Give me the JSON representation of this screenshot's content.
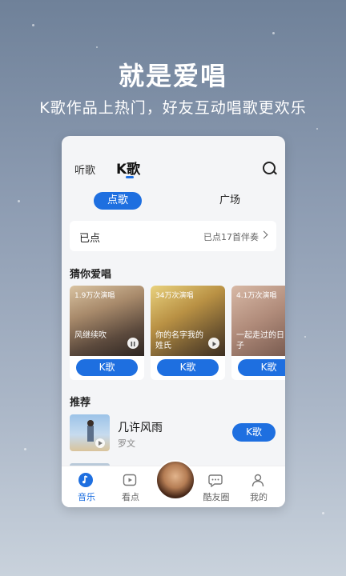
{
  "headline": "就是爱唱",
  "subline": "K歌作品上热门，好友互动唱歌更欢乐",
  "topbar": {
    "tab_listen": "听歌",
    "tab_k": "K歌"
  },
  "segments": {
    "active": "点歌",
    "plaza": "广场"
  },
  "ordered": {
    "label": "已点",
    "count": "已点17首伴奏"
  },
  "guess": {
    "title": "猜你爱唱",
    "cards": [
      {
        "plays": "1.9万次演唱",
        "song": "风继续吹",
        "button": "K歌"
      },
      {
        "plays": "34万次演唱",
        "song": "你的名字我的姓氏",
        "button": "K歌"
      },
      {
        "plays": "4.1万次演唱",
        "song": "一起走过的日子",
        "button": "K歌"
      }
    ]
  },
  "recommend": {
    "title": "推荐",
    "items": [
      {
        "title": "几许风雨",
        "artist": "罗文",
        "button": "K歌"
      }
    ]
  },
  "nav": {
    "music": "音乐",
    "watch": "看点",
    "circle": "酷友圈",
    "mine": "我的"
  },
  "colors": {
    "accent": "#1e6fe0"
  }
}
